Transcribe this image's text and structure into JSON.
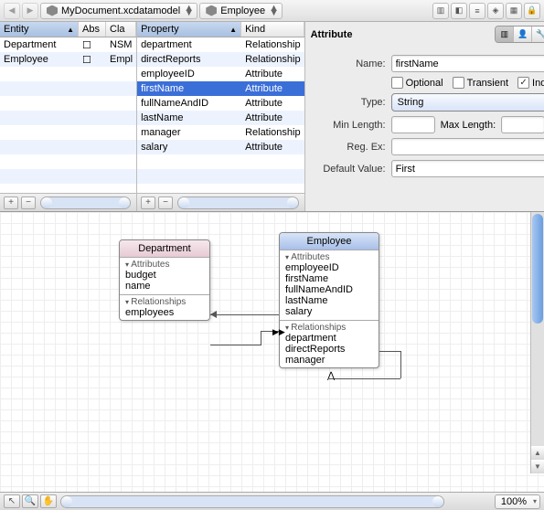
{
  "toolbar": {
    "path_document": "MyDocument.xcdatamodel",
    "path_entity": "Employee"
  },
  "entity_table": {
    "header": [
      "Entity",
      "Abs",
      "Cla"
    ],
    "rows": [
      {
        "name": "Department",
        "abs": false,
        "cls": "NSM"
      },
      {
        "name": "Employee",
        "abs": false,
        "cls": "Empl"
      }
    ]
  },
  "property_table": {
    "header": [
      "Property",
      "Kind"
    ],
    "rows": [
      {
        "name": "department",
        "kind": "Relationship"
      },
      {
        "name": "directReports",
        "kind": "Relationship"
      },
      {
        "name": "employeeID",
        "kind": "Attribute"
      },
      {
        "name": "firstName",
        "kind": "Attribute",
        "selected": true
      },
      {
        "name": "fullNameAndID",
        "kind": "Attribute"
      },
      {
        "name": "lastName",
        "kind": "Attribute"
      },
      {
        "name": "manager",
        "kind": "Relationship"
      },
      {
        "name": "salary",
        "kind": "Attribute"
      }
    ]
  },
  "inspector": {
    "section": "Attribute",
    "name_label": "Name:",
    "name_value": "firstName",
    "optional_label": "Optional",
    "optional_checked": false,
    "transient_label": "Transient",
    "transient_checked": false,
    "indexed_label": "Indexed",
    "indexed_checked": true,
    "type_label": "Type:",
    "type_value": "String",
    "minlen_label": "Min Length:",
    "minlen_value": "",
    "maxlen_label": "Max Length:",
    "maxlen_value": "",
    "regex_label": "Reg. Ex:",
    "regex_value": "",
    "default_label": "Default Value:",
    "default_value": "First"
  },
  "diagram": {
    "department": {
      "title": "Department",
      "attrs_label": "Attributes",
      "attrs": [
        "budget",
        "name"
      ],
      "rels_label": "Relationships",
      "rels": [
        "employees"
      ]
    },
    "employee": {
      "title": "Employee",
      "attrs_label": "Attributes",
      "attrs": [
        "employeeID",
        "firstName",
        "fullNameAndID",
        "lastName",
        "salary"
      ],
      "rels_label": "Relationships",
      "rels": [
        "department",
        "directReports",
        "manager"
      ]
    }
  },
  "zoom": "100%"
}
